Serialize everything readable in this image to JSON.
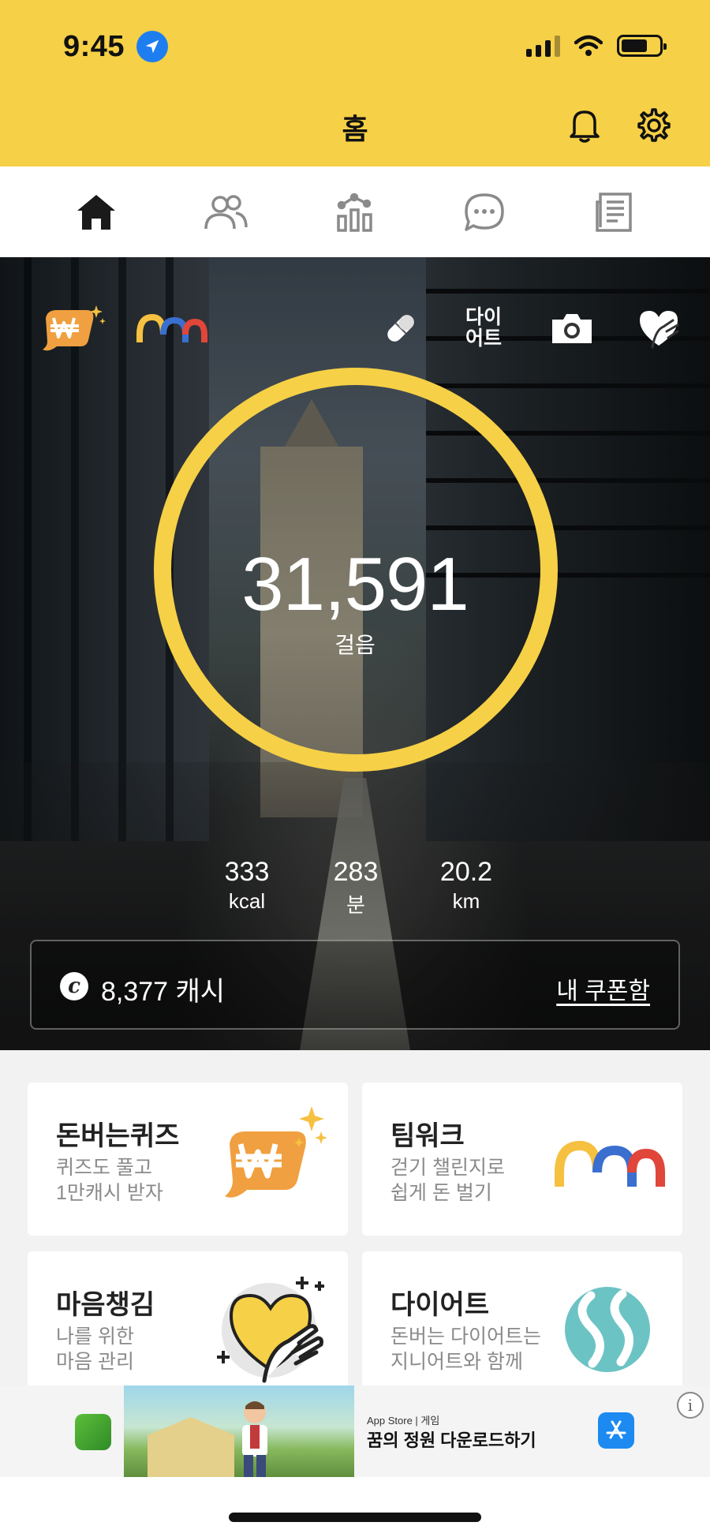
{
  "status_bar": {
    "time": "9:45",
    "location_icon": "location-arrow-icon",
    "signal_icon": "cellular-signal-icon",
    "wifi_icon": "wifi-icon",
    "battery_icon": "battery-icon"
  },
  "header": {
    "title": "홈",
    "bell_icon": "bell-icon",
    "settings_icon": "gear-icon",
    "background_color": "#f6d046"
  },
  "tabs": [
    {
      "id": "home",
      "icon": "home-icon",
      "selected": true
    },
    {
      "id": "friends",
      "icon": "people-icon",
      "selected": false
    },
    {
      "id": "stats",
      "icon": "chart-icon",
      "selected": false
    },
    {
      "id": "chat",
      "icon": "chat-icon",
      "selected": false
    },
    {
      "id": "news",
      "icon": "newspaper-icon",
      "selected": false
    }
  ],
  "hero": {
    "quiz_icon": "won-quiz-icon",
    "teamwork_icon": "teamwork-logo-icon",
    "pill_icon": "pill-icon",
    "diet_label_line1": "다이",
    "diet_label_line2": "어트",
    "camera_icon": "camera-icon",
    "heart_hand_icon": "heart-hand-icon",
    "steps_value": "31,591",
    "steps_unit": "걸음",
    "ring_color": "#f6d046",
    "stats": [
      {
        "value": "333",
        "unit": "kcal"
      },
      {
        "value": "283",
        "unit": "분"
      },
      {
        "value": "20.2",
        "unit": "km"
      }
    ],
    "cash": {
      "icon_letter": "c",
      "amount_text": "8,377 캐시",
      "coupon_link": "내 쿠폰함"
    }
  },
  "cards": [
    {
      "title": "돈버는퀴즈",
      "sub1": "퀴즈도 풀고",
      "sub2": "1만캐시 받자",
      "icon": "won-quiz-icon"
    },
    {
      "title": "팀워크",
      "sub1": "걷기 챌린지로",
      "sub2": "쉽게 돈 벌기",
      "icon": "teamwork-logo-icon"
    },
    {
      "title": "마음챙김",
      "sub1": "나를 위한",
      "sub2": "마음 관리",
      "icon": "heart-hand-icon"
    },
    {
      "title": "다이어트",
      "sub1": "돈버는 다이어트는",
      "sub2": "지니어트와 함께",
      "icon": "ginieat-logo-icon"
    }
  ],
  "ad": {
    "store_label": " App Store | 게임",
    "title": "꿈의 정원 다운로드하기",
    "info_label": "i",
    "store_button_icon": "app-store-icon",
    "app_icon": "game-app-icon"
  }
}
